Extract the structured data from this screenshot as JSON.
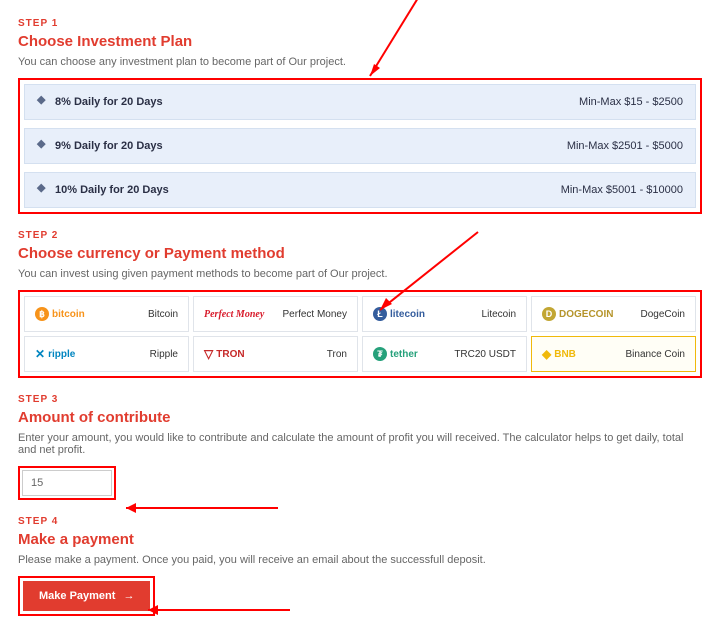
{
  "step1": {
    "label": "STEP 1",
    "title": "Choose Investment Plan",
    "desc": "You can choose any investment plan to become part of Our project.",
    "plans": [
      {
        "name": "8% Daily for 20 Days",
        "range": "Min-Max $15 - $2500"
      },
      {
        "name": "9% Daily for 20 Days",
        "range": "Min-Max $2501 - $5000"
      },
      {
        "name": "10% Daily for 20 Days",
        "range": "Min-Max $5001 - $10000"
      }
    ]
  },
  "step2": {
    "label": "STEP 2",
    "title": "Choose currency or Payment method",
    "desc": "You can invest using given payment methods to become part of Our project.",
    "methods": [
      {
        "logo": "bitcoin",
        "label": "Bitcoin"
      },
      {
        "logo": "Perfect Money",
        "label": "Perfect Money"
      },
      {
        "logo": "litecoin",
        "label": "Litecoin"
      },
      {
        "logo": "DOGECOIN",
        "label": "DogeCoin"
      },
      {
        "logo": "ripple",
        "label": "Ripple"
      },
      {
        "logo": "TRON",
        "label": "Tron"
      },
      {
        "logo": "tether",
        "label": "TRC20 USDT"
      },
      {
        "logo": "BNB",
        "label": "Binance Coin",
        "selected": true
      }
    ]
  },
  "step3": {
    "label": "STEP 3",
    "title": "Amount of contribute",
    "desc": "Enter your amount, you would like to contribute and calculate the amount of profit you will received. The calculator helps to get daily, total and net profit.",
    "amount_value": "15"
  },
  "step4": {
    "label": "STEP 4",
    "title": "Make a payment",
    "desc": "Please make a payment. Once you paid, you will receive an email about the successfull deposit.",
    "button_label": "Make Payment"
  }
}
